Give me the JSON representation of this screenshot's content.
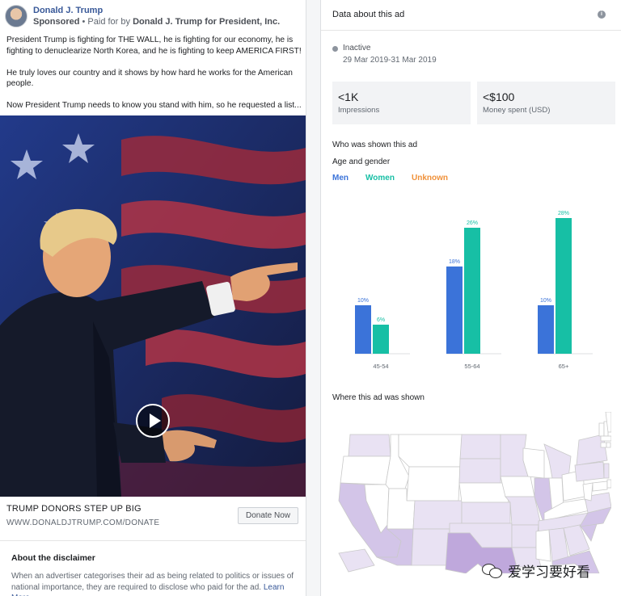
{
  "ad": {
    "page_name": "Donald J. Trump",
    "sponsored": "Sponsored",
    "paid_for_prefix": "• Paid for by ",
    "paid_for_by": "Donald J. Trump for President, Inc.",
    "text_paragraphs": [
      "President Trump is fighting for THE WALL, he is fighting for our economy, he is fighting to denuclearize North Korea, and he is fighting to keep AMERICA FIRST!",
      "He truly loves our country and it shows by how hard he works for the American people.",
      "Now President Trump needs to know you stand with him, so he requested a list..."
    ],
    "cta_title": "TRUMP DONORS STEP UP BIG",
    "cta_url": "WWW.DONALDJTRUMP.COM/DONATE",
    "cta_button": "Donate Now"
  },
  "disclaimer": {
    "title": "About the disclaimer",
    "text": "When an advertiser categorises their ad as being related to politics or issues of national importance, they are required to disclose who paid for the ad.",
    "learn_more": "Learn More"
  },
  "panel": {
    "title": "Data about this ad",
    "info_icon": "i",
    "status": "Inactive",
    "date_range": "29 Mar 2019-31 Mar 2019",
    "impressions_value": "<1K",
    "impressions_label": "Impressions",
    "spend_value": "<$100",
    "spend_label": "Money spent (USD)",
    "who_title": "Who was shown this ad",
    "age_title": "Age and gender",
    "where_title": "Where this ad was shown"
  },
  "chart_data": {
    "type": "bar",
    "categories": [
      "45-54",
      "55-64",
      "65+"
    ],
    "series": [
      {
        "name": "Men",
        "values": [
          10,
          18,
          10
        ],
        "labels": [
          "10%",
          "18%",
          "10%"
        ],
        "color": "#3b73d9"
      },
      {
        "name": "Women",
        "values": [
          6,
          26,
          28
        ],
        "labels": [
          "6%",
          "26%",
          "28%"
        ],
        "color": "#17bfa5"
      },
      {
        "name": "Unknown",
        "values": [
          0,
          0,
          0
        ],
        "labels": [
          "",
          "",
          ""
        ],
        "color": "#f0913a"
      }
    ],
    "ylim": [
      0,
      30
    ],
    "grid": false
  },
  "map": {
    "states": [
      {
        "name": "WA",
        "shade": 1
      },
      {
        "name": "OR",
        "shade": 0
      },
      {
        "name": "CA",
        "shade": 2
      },
      {
        "name": "NV",
        "shade": 0
      },
      {
        "name": "ID",
        "shade": 0
      },
      {
        "name": "MT",
        "shade": 0
      },
      {
        "name": "WY",
        "shade": 0
      },
      {
        "name": "UT",
        "shade": 0
      },
      {
        "name": "AZ",
        "shade": 2
      },
      {
        "name": "CO",
        "shade": 1
      },
      {
        "name": "NM",
        "shade": 1
      },
      {
        "name": "ND",
        "shade": 1
      },
      {
        "name": "SD",
        "shade": 1
      },
      {
        "name": "NE",
        "shade": 0
      },
      {
        "name": "KS",
        "shade": 1
      },
      {
        "name": "OK",
        "shade": 1
      },
      {
        "name": "TX",
        "shade": 3
      },
      {
        "name": "MN",
        "shade": 1
      },
      {
        "name": "IA",
        "shade": 0
      },
      {
        "name": "MO",
        "shade": 1
      },
      {
        "name": "AR",
        "shade": 1
      },
      {
        "name": "LA",
        "shade": 1
      },
      {
        "name": "WI",
        "shade": 0
      },
      {
        "name": "IL",
        "shade": 2
      },
      {
        "name": "MI",
        "shade": 1
      },
      {
        "name": "IN",
        "shade": 0
      },
      {
        "name": "OH",
        "shade": 0
      },
      {
        "name": "KY",
        "shade": 0
      },
      {
        "name": "TN",
        "shade": 1
      },
      {
        "name": "MS",
        "shade": 0
      },
      {
        "name": "AL",
        "shade": 1
      },
      {
        "name": "GA",
        "shade": 1
      },
      {
        "name": "FL",
        "shade": 2
      },
      {
        "name": "SC",
        "shade": 2
      },
      {
        "name": "NC",
        "shade": 2
      },
      {
        "name": "VA",
        "shade": 1
      },
      {
        "name": "WV",
        "shade": 0
      },
      {
        "name": "PA",
        "shade": 1
      },
      {
        "name": "NY",
        "shade": 1
      },
      {
        "name": "ME",
        "shade": 0
      },
      {
        "name": "VT",
        "shade": 0
      },
      {
        "name": "NH",
        "shade": 0
      },
      {
        "name": "MA",
        "shade": 0
      },
      {
        "name": "NJ",
        "shade": 1
      },
      {
        "name": "MD",
        "shade": 0
      },
      {
        "name": "DE",
        "shade": 0
      },
      {
        "name": "CT",
        "shade": 0
      },
      {
        "name": "RI",
        "shade": 0
      },
      {
        "name": "AK",
        "shade": 1
      }
    ],
    "palette": [
      "#ffffff",
      "#e9e2f3",
      "#d3c5e8",
      "#bfa8dc"
    ]
  },
  "watermark": {
    "text": "爱学习要好看"
  }
}
